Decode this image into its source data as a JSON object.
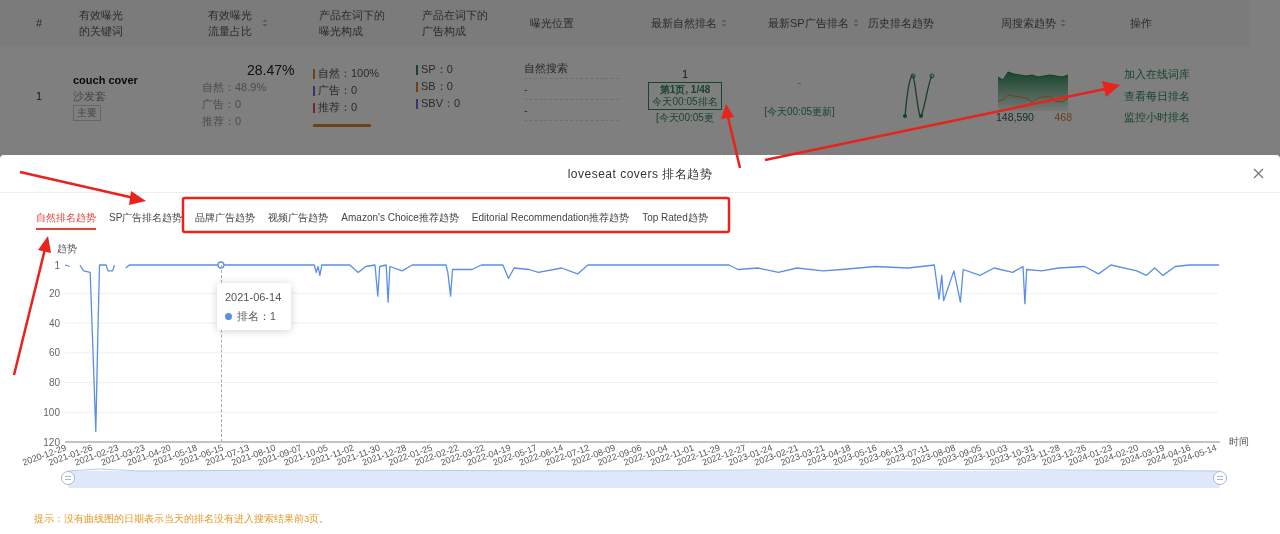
{
  "table": {
    "columns": [
      {
        "label": "#",
        "sortable": false
      },
      {
        "label": "有效曝光的关键词",
        "sortable": false
      },
      {
        "label": "有效曝光流量占比",
        "sortable": true
      },
      {
        "label": "产品在词下的曝光构成",
        "sortable": false
      },
      {
        "label": "产品在词下的广告构成",
        "sortable": false
      },
      {
        "label": "曝光位置",
        "sortable": false
      },
      {
        "label": "最新自然排名",
        "sortable": true
      },
      {
        "label": "最新SP广告排名",
        "sortable": true
      },
      {
        "label": "历史排名趋势",
        "sortable": false
      },
      {
        "label": "周搜索趋势",
        "sortable": true
      },
      {
        "label": "操作",
        "sortable": false
      }
    ],
    "rows": [
      {
        "index": "1",
        "keyword": "couch cover",
        "translation": "沙发套",
        "tag": "主要",
        "share": "28.47%",
        "share_breakdown": [
          "自然：48.9%",
          "广告：0",
          "推荐：0"
        ],
        "exposure": [
          {
            "text": "自然：100%",
            "color": "#704116"
          },
          {
            "text": "广告：0",
            "color": "#35376b"
          },
          {
            "text": "推荐：0",
            "color": "#702929"
          }
        ],
        "exposure_bar": {
          "level": 1
        },
        "ads": [
          {
            "text": "SP：0",
            "color": "#17452b"
          },
          {
            "text": "SB：0",
            "color": "#704116"
          },
          {
            "text": "SBV：0",
            "color": "#35376b"
          }
        ],
        "placement": [
          "自然搜索",
          "-",
          "-"
        ],
        "organic_rank": {
          "rank": "1",
          "page": "第1页, 1/48",
          "ranked": "今天00:05排名",
          "updated": "[今天00:05更"
        },
        "sp_rank": {
          "rank": "-",
          "updated": "[今天00:05更新]"
        },
        "search_trend": {
          "volume": "148,590",
          "second": "468"
        },
        "actions": [
          "加入在线词库",
          "查看每日排名",
          "监控小时排名"
        ]
      }
    ]
  },
  "modal": {
    "title": "loveseat covers 排名趋势",
    "tabs": [
      {
        "label": "自然排名趋势",
        "selected": true
      },
      {
        "label": "SP广告排名趋势",
        "selected": false
      },
      {
        "label": "品牌广告趋势",
        "selected": false
      },
      {
        "label": "视频广告趋势",
        "selected": false
      },
      {
        "label": "Amazon's Choice推荐趋势",
        "selected": false
      },
      {
        "label": "Editorial Recommendation推荐趋势",
        "selected": false
      },
      {
        "label": "Top Rated趋势",
        "selected": false
      }
    ],
    "chart": {
      "chart_data": {
        "type": "line",
        "ylabel": "趋势",
        "xlabel": "时间",
        "grid": true,
        "ylim": [
          120,
          1
        ],
        "xlim": [
          "2020-12-29",
          "2024-05-19"
        ],
        "yticks": [
          1,
          20,
          40,
          60,
          80,
          100,
          120
        ],
        "xticks": [
          "2020-12-29",
          "2021-01-26",
          "2021-02-23",
          "2021-03-23",
          "2021-04-20",
          "2021-05-18",
          "2021-06-15",
          "2021-07-13",
          "2021-08-10",
          "2021-09-07",
          "2021-10-05",
          "2021-11-02",
          "2021-11-30",
          "2021-12-28",
          "2022-01-25",
          "2022-02-22",
          "2022-03-22",
          "2022-04-19",
          "2022-05-17",
          "2022-06-14",
          "2022-07-12",
          "2022-08-09",
          "2022-09-06",
          "2022-10-04",
          "2022-11-01",
          "2022-11-29",
          "2022-12-27",
          "2023-01-24",
          "2023-02-21",
          "2023-03-21",
          "2023-04-18",
          "2023-05-16",
          "2023-06-13",
          "2023-07-11",
          "2023-08-08",
          "2023-09-05",
          "2023-10-03",
          "2023-10-31",
          "2023-11-28",
          "2023-12-26",
          "2024-01-23",
          "2024-02-20",
          "2024-03-19",
          "2024-04-16",
          "2024-05-14"
        ],
        "x": [
          "2020-12-29",
          "2021-01-03",
          "2021-01-07",
          "2021-01-14",
          "2021-01-18",
          "2021-01-25",
          "2021-01-31",
          "2021-02-02",
          "2021-02-04",
          "2021-02-11",
          "2021-02-13",
          "2021-02-18",
          "2021-02-20",
          "2021-02-22",
          "2021-03-04",
          "2021-03-08",
          "2021-04-20",
          "2021-06-14",
          "2021-08-10",
          "2021-09-22",
          "2021-09-24",
          "2021-09-26",
          "2021-09-28",
          "2021-09-30",
          "2021-10-30",
          "2021-11-08",
          "2021-11-16",
          "2021-11-26",
          "2021-11-29",
          "2021-12-01",
          "2021-12-08",
          "2021-12-10",
          "2021-12-12",
          "2021-12-25",
          "2022-01-05",
          "2022-02-10",
          "2022-02-12",
          "2022-02-15",
          "2022-02-17",
          "2022-03-10",
          "2022-03-20",
          "2022-04-12",
          "2022-04-18",
          "2022-04-24",
          "2022-05-10",
          "2022-05-20",
          "2022-06-14",
          "2022-07-01",
          "2022-07-12",
          "2022-09-06",
          "2022-10-04",
          "2022-12-10",
          "2022-12-20",
          "2023-01-10",
          "2023-02-01",
          "2023-02-21",
          "2023-03-21",
          "2023-04-10",
          "2023-05-16",
          "2023-06-20",
          "2023-07-18",
          "2023-07-23",
          "2023-07-26",
          "2023-07-28",
          "2023-08-08",
          "2023-08-15",
          "2023-08-18",
          "2023-09-05",
          "2023-09-20",
          "2023-10-10",
          "2023-10-21",
          "2023-10-23",
          "2023-10-25",
          "2023-11-10",
          "2023-11-28",
          "2023-12-26",
          "2024-01-10",
          "2024-01-23",
          "2024-02-20",
          "2024-03-01",
          "2024-03-10",
          "2024-03-19",
          "2024-04-01",
          "2024-04-16",
          "2024-05-14",
          "2024-05-18"
        ],
        "series": [
          {
            "color": "#5a8fe6",
            "values": [
              1,
              2,
              null,
              1,
              5,
              6,
              113,
              52,
              1,
              1,
              5,
              5,
              1,
              null,
              3,
              1,
              1,
              1,
              1,
              1,
              6,
              2,
              8,
              1,
              1,
              6,
              2,
              1,
              22,
              2,
              1,
              26,
              2,
              5,
              1,
              1,
              6,
              22,
              4,
              4,
              1,
              1,
              10,
              3,
              4,
              6,
              3,
              7,
              1,
              1,
              1,
              1,
              4,
              3,
              6,
              3,
              5,
              4,
              2,
              3,
              1,
              24,
              8,
              25,
              5,
              26,
              4,
              8,
              3,
              6,
              2,
              27,
              4,
              5,
              3,
              2,
              7,
              1,
              5,
              8,
              3,
              8,
              2,
              1,
              1,
              1
            ]
          }
        ]
      },
      "tooltip": {
        "date": "2021-06-14",
        "label": "排名：1"
      }
    },
    "tip": "提示：没有曲线图的日期表示当天的排名没有进入搜索结果前3页。"
  }
}
